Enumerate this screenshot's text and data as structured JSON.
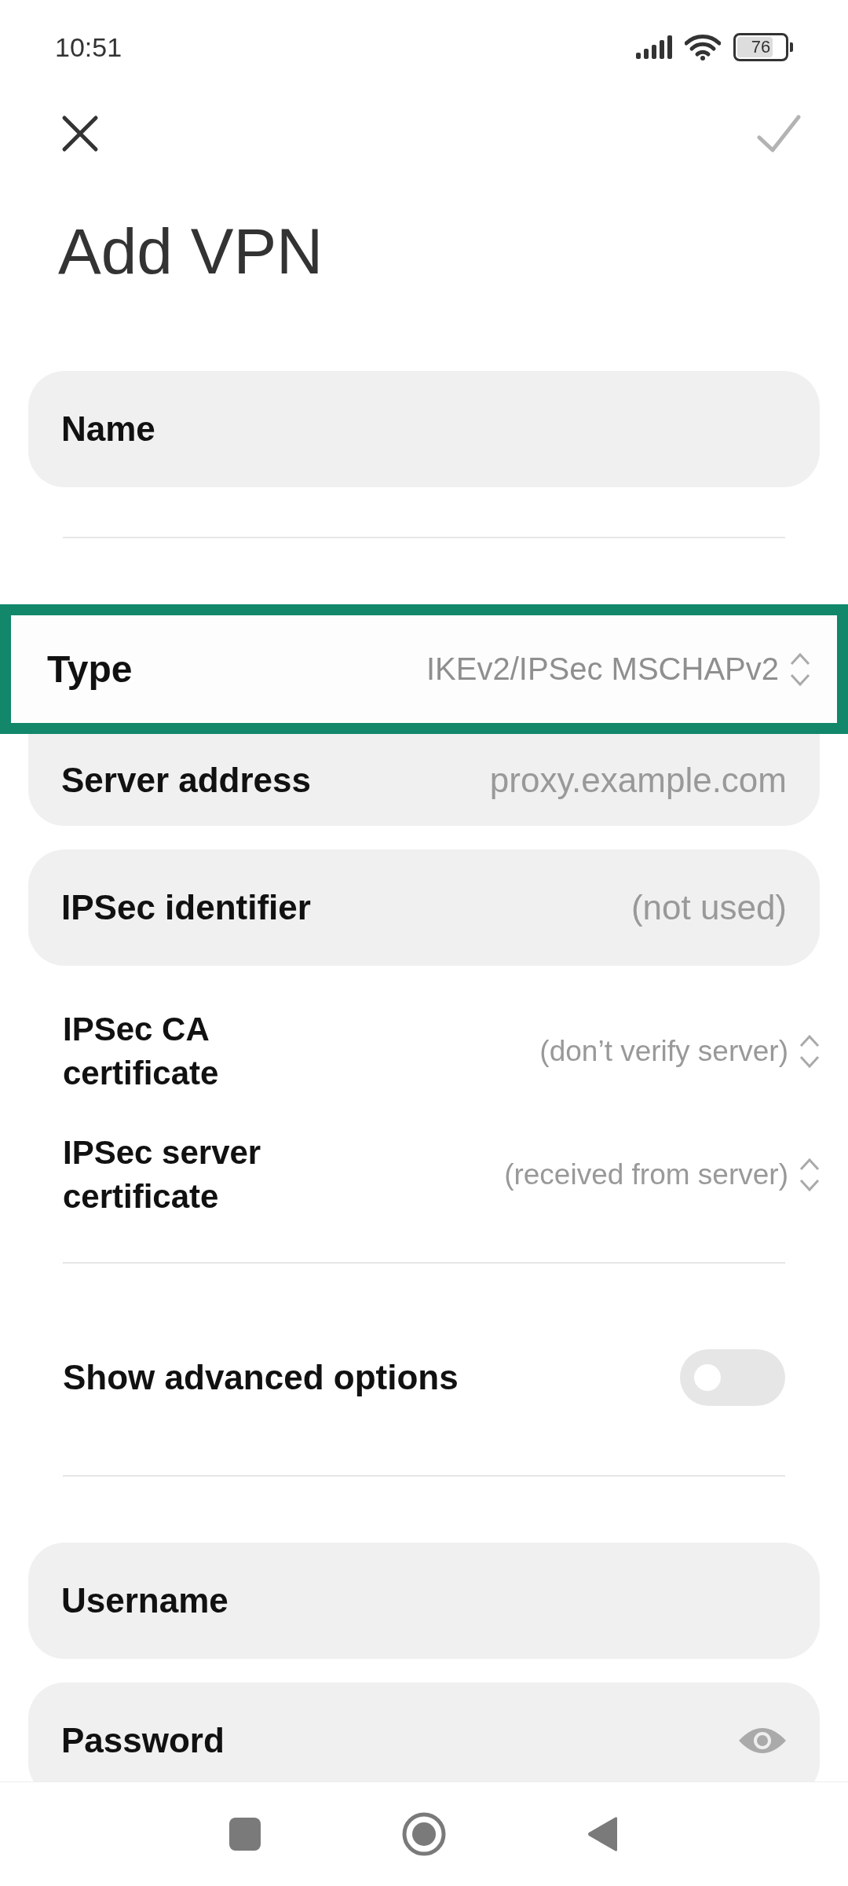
{
  "status_bar": {
    "time": "10:51",
    "battery": "76"
  },
  "title": "Add VPN",
  "form": [
    {
      "kind": "field",
      "label": "Name"
    },
    {
      "kind": "divider"
    },
    {
      "kind": "select_row",
      "label": "Type",
      "value": "IKEv2/IPSec MSCHAPv2",
      "highlighted": true
    },
    {
      "kind": "field",
      "label": "Server address",
      "placeholder": "proxy.example.com"
    },
    {
      "kind": "field",
      "label": "IPSec identifier",
      "placeholder": "(not used)"
    },
    {
      "kind": "select",
      "label": "IPSec CA certificate",
      "value": "(don’t verify server)"
    },
    {
      "kind": "select",
      "label": "IPSec server certificate",
      "value": "(received from server)"
    },
    {
      "kind": "divider"
    },
    {
      "kind": "toggle",
      "label": "Show advanced options",
      "on": false
    },
    {
      "kind": "divider"
    },
    {
      "kind": "field",
      "label": "Username"
    },
    {
      "kind": "password",
      "label": "Password"
    }
  ]
}
